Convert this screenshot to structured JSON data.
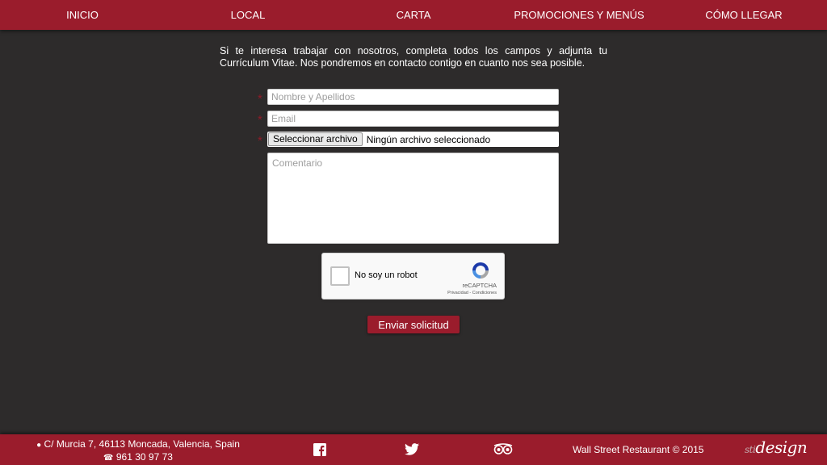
{
  "nav": {
    "items": [
      {
        "label": "INICIO"
      },
      {
        "label": "LOCAL"
      },
      {
        "label": "CARTA"
      },
      {
        "label": "PROMOCIONES Y MENÚS"
      },
      {
        "label": "CÓMO LLEGAR"
      }
    ]
  },
  "intro": {
    "text": "Si te interesa trabajar con nosotros, completa todos los campos y adjunta tu Currículum Vitae. Nos pondremos en contacto contigo en cuanto nos sea posible."
  },
  "form": {
    "required_mark": "*",
    "name": {
      "placeholder": "Nombre y Apellidos",
      "value": ""
    },
    "email": {
      "placeholder": "Email",
      "value": ""
    },
    "file": {
      "button_label": "Seleccionar archivo",
      "status": "Ningún archivo seleccionado"
    },
    "comment": {
      "placeholder": "Comentario",
      "value": ""
    },
    "submit_label": "Enviar solicitud"
  },
  "recaptcha": {
    "label": "No soy un robot",
    "brand": "reCAPTCHA",
    "links": "Privacidad - Condiciones",
    "checked": false
  },
  "footer": {
    "address": "C/ Murcia 7, 46113 Moncada, Valencia, Spain",
    "phone": "961 30 97 73",
    "copyright": "Wall Street Restaurant © 2015",
    "brand_prefix": "sti",
    "brand_name": "design",
    "social": [
      "facebook-icon",
      "twitter-icon",
      "tripadvisor-icon"
    ]
  },
  "colors": {
    "accent": "#9a1c2c",
    "background": "#2d2b2b",
    "required": "#8f1b28"
  }
}
